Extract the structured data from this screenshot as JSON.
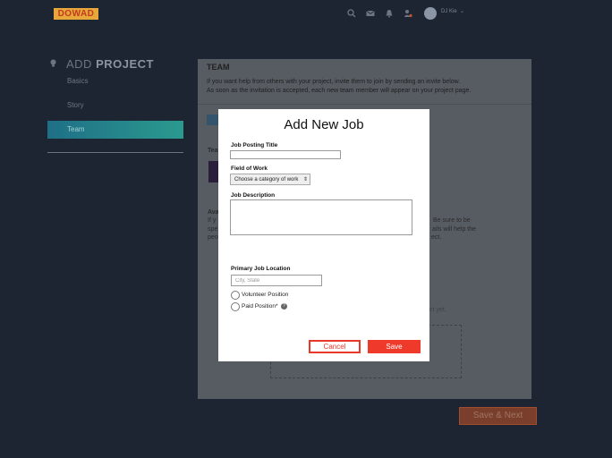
{
  "app": {
    "logo_text": "DOWAD"
  },
  "header": {
    "user_name": "DJ Kie",
    "chevron": "⌄"
  },
  "icons": {
    "search": "search-icon",
    "mail": "mail-icon",
    "bell": "bell-icon",
    "user": "user-notification-icon",
    "project": "lightbulb-icon",
    "help": "help-icon"
  },
  "sidebar": {
    "title_prefix": "ADD",
    "title_bold": "PROJECT",
    "items": [
      {
        "label": "Basics"
      },
      {
        "label": "Story"
      },
      {
        "label": "Team"
      }
    ]
  },
  "panel": {
    "title": "TEAM",
    "intro_line1": "If you want help from others with your project, invite them to join by sending an invite below.",
    "intro_line2": "As soon as the invitation is accepted, each new team member will appear on your project page.",
    "frag_team": "Tea",
    "frag_ava": "Ava",
    "frag_if": "If y",
    "frag_spe": "spe",
    "frag_pe": "peo",
    "frag_be_sure": "Be sure to be",
    "frag_ils": "ails will help the",
    "frag_ct": "ect.",
    "frag_yet": "ct yet."
  },
  "footer": {
    "save_next": "Save & Next"
  },
  "modal": {
    "title": "Add New Job",
    "job_title_label": "Job Posting Title",
    "job_title_value": "",
    "field_label": "Field of Work",
    "field_selected": "Choose a category of work",
    "field_chevron": "⇕",
    "description_label": "Job Description",
    "description_value": "",
    "location_label": "Primary Job Location",
    "location_placeholder": "City, State",
    "volunteer_label": "Volunteer Position",
    "paid_label": "Paid Position*",
    "help_glyph": "?",
    "cancel": "Cancel",
    "save": "Save"
  },
  "colors": {
    "accent": "#ef3a2b",
    "overlay": "#1e2532",
    "sidebar_active": "#2a9a8f"
  }
}
